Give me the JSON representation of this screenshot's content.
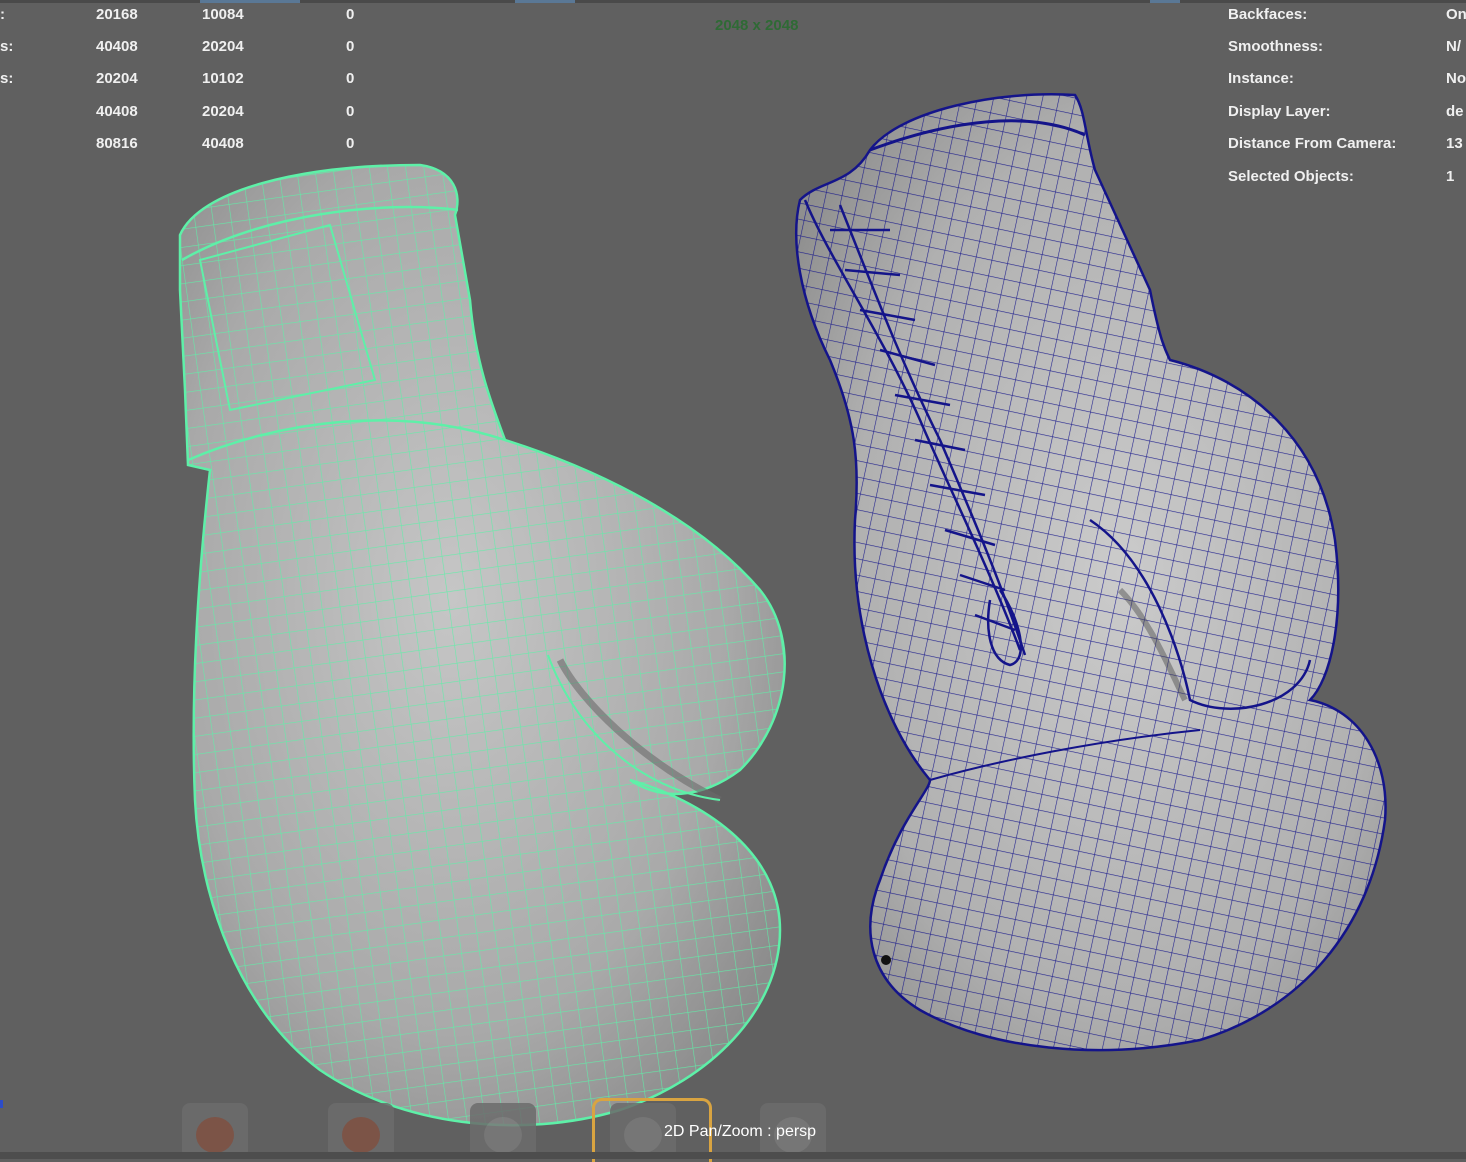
{
  "hud_left": {
    "rows": [
      {
        "label": ":",
        "a": "20168",
        "b": "10084",
        "c": "0"
      },
      {
        "label": "s:",
        "a": "40408",
        "b": "20204",
        "c": "0"
      },
      {
        "label": "s:",
        "a": "20204",
        "b": "10102",
        "c": "0"
      },
      {
        "label": "",
        "a": "40408",
        "b": "20204",
        "c": "0"
      },
      {
        "label": "",
        "a": "80816",
        "b": "40408",
        "c": "0"
      }
    ]
  },
  "hud_center": {
    "resolution": "2048 x 2048"
  },
  "hud_right": {
    "rows": [
      {
        "label": "Backfaces:",
        "value": "On"
      },
      {
        "label": "Smoothness:",
        "value": "N/"
      },
      {
        "label": "Instance:",
        "value": "No"
      },
      {
        "label": "Display Layer:",
        "value": "de"
      },
      {
        "label": "Distance From Camera:",
        "value": "13"
      },
      {
        "label": "Selected Objects:",
        "value": "1"
      }
    ]
  },
  "viewport": {
    "camera_label": "2D Pan/Zoom : persp",
    "left_object_wire_color": "#5ef0a8",
    "right_object_wire_color": "#14148a",
    "mesh_color": "#b4b4b4",
    "background_color": "#606060"
  },
  "shelf": {
    "icons": [
      "glove-pair-thumbnail",
      "glove-pair-thumbnail",
      "glove-thumbnail",
      "glove-thumbnail-active",
      "glove-thumbnail"
    ]
  }
}
